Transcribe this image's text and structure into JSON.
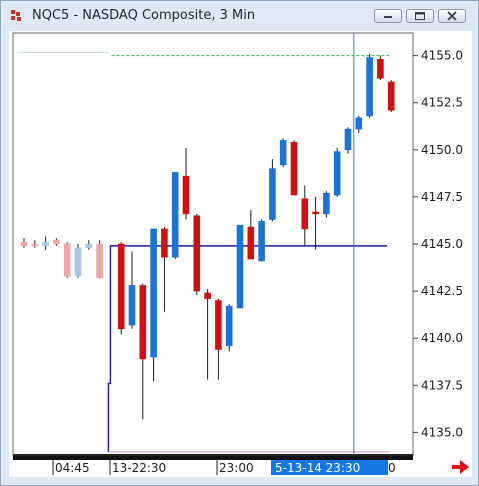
{
  "window": {
    "title": "NQC5 - NASDAQ Composite, 3 Min"
  },
  "chart_data": {
    "type": "candlestick",
    "symbol": "NQC5",
    "ylim": [
      4133.8,
      4156.2
    ],
    "price_ticks": [
      "4155.0",
      "4152.5",
      "4150.0",
      "4147.5",
      "4145.0",
      "4142.5",
      "4140.0",
      "4137.5",
      "4135.0"
    ],
    "price_tick_values": [
      4155.0,
      4152.5,
      4150.0,
      4147.5,
      4145.0,
      4142.5,
      4140.0,
      4137.5,
      4135.0
    ],
    "time_labels": [
      "04:45",
      "13-22:30",
      "23:00"
    ],
    "cursor_time_label": "5-13-14  23:30",
    "cursor_time_suffix": "0",
    "bar_count_total": 37,
    "ghost_candles": [
      {
        "i": 0,
        "o": 4145.1,
        "h": 4145.3,
        "l": 4144.8,
        "c": 4144.9,
        "dir": "down"
      },
      {
        "i": 1,
        "o": 4145.0,
        "h": 4145.2,
        "l": 4144.8,
        "c": 4144.9,
        "dir": "down"
      },
      {
        "i": 2,
        "o": 4144.9,
        "h": 4145.4,
        "l": 4144.7,
        "c": 4145.1,
        "dir": "up"
      },
      {
        "i": 3,
        "o": 4145.2,
        "h": 4145.3,
        "l": 4144.9,
        "c": 4145.0,
        "dir": "down"
      },
      {
        "i": 4,
        "o": 4145.0,
        "h": 4145.1,
        "l": 4143.2,
        "c": 4143.3,
        "dir": "down"
      },
      {
        "i": 5,
        "o": 4143.3,
        "h": 4145.0,
        "l": 4143.2,
        "c": 4144.8,
        "dir": "up"
      },
      {
        "i": 6,
        "o": 4144.8,
        "h": 4145.2,
        "l": 4144.7,
        "c": 4145.0,
        "dir": "up"
      },
      {
        "i": 7,
        "o": 4145.0,
        "h": 4145.2,
        "l": 4143.2,
        "c": 4143.2,
        "dir": "down"
      }
    ],
    "candles": [
      {
        "i": 9,
        "o": 4145.0,
        "h": 4145.1,
        "l": 4140.2,
        "c": 4140.5,
        "dir": "down"
      },
      {
        "i": 10,
        "o": 4140.7,
        "h": 4144.6,
        "l": 4140.5,
        "c": 4142.8,
        "dir": "up"
      },
      {
        "i": 11,
        "o": 4142.8,
        "h": 4142.9,
        "l": 4135.7,
        "c": 4138.9,
        "dir": "down"
      },
      {
        "i": 12,
        "o": 4139.0,
        "h": 4145.8,
        "l": 4137.7,
        "c": 4145.8,
        "dir": "up"
      },
      {
        "i": 13,
        "o": 4145.8,
        "h": 4145.9,
        "l": 4141.4,
        "c": 4144.3,
        "dir": "down"
      },
      {
        "i": 14,
        "o": 4144.3,
        "h": 4148.8,
        "l": 4144.2,
        "c": 4148.8,
        "dir": "up"
      },
      {
        "i": 15,
        "o": 4148.6,
        "h": 4150.1,
        "l": 4146.3,
        "c": 4146.6,
        "dir": "down"
      },
      {
        "i": 16,
        "o": 4146.5,
        "h": 4146.6,
        "l": 4142.3,
        "c": 4142.5,
        "dir": "down"
      },
      {
        "i": 17,
        "o": 4142.4,
        "h": 4142.6,
        "l": 4137.8,
        "c": 4142.1,
        "dir": "down"
      },
      {
        "i": 18,
        "o": 4142.0,
        "h": 4142.1,
        "l": 4137.8,
        "c": 4139.4,
        "dir": "down"
      },
      {
        "i": 19,
        "o": 4139.6,
        "h": 4141.8,
        "l": 4139.3,
        "c": 4141.7,
        "dir": "up"
      },
      {
        "i": 20,
        "o": 4141.6,
        "h": 4146.0,
        "l": 4141.6,
        "c": 4146.0,
        "dir": "up"
      },
      {
        "i": 21,
        "o": 4145.9,
        "h": 4146.8,
        "l": 4144.2,
        "c": 4144.2,
        "dir": "down"
      },
      {
        "i": 22,
        "o": 4144.1,
        "h": 4146.3,
        "l": 4144.1,
        "c": 4146.2,
        "dir": "up"
      },
      {
        "i": 23,
        "o": 4146.3,
        "h": 4149.5,
        "l": 4146.2,
        "c": 4149.0,
        "dir": "up"
      },
      {
        "i": 24,
        "o": 4149.2,
        "h": 4150.6,
        "l": 4149.1,
        "c": 4150.5,
        "dir": "up"
      },
      {
        "i": 25,
        "o": 4150.4,
        "h": 4150.5,
        "l": 4147.6,
        "c": 4147.6,
        "dir": "down"
      },
      {
        "i": 26,
        "o": 4147.4,
        "h": 4148.1,
        "l": 4144.9,
        "c": 4145.8,
        "dir": "down"
      },
      {
        "i": 27,
        "o": 4146.6,
        "h": 4147.5,
        "l": 4144.7,
        "c": 4146.7,
        "dir": "down"
      },
      {
        "i": 28,
        "o": 4146.6,
        "h": 4147.8,
        "l": 4146.4,
        "c": 4147.7,
        "dir": "up"
      },
      {
        "i": 29,
        "o": 4147.6,
        "h": 4150.1,
        "l": 4147.5,
        "c": 4149.9,
        "dir": "up"
      },
      {
        "i": 30,
        "o": 4150.0,
        "h": 4151.2,
        "l": 4149.8,
        "c": 4151.1,
        "dir": "up"
      },
      {
        "i": 31,
        "o": 4151.1,
        "h": 4151.8,
        "l": 4150.9,
        "c": 4151.7,
        "dir": "up"
      },
      {
        "i": 32,
        "o": 4151.8,
        "h": 4155.1,
        "l": 4151.7,
        "c": 4154.9,
        "dir": "up"
      },
      {
        "i": 33,
        "o": 4154.8,
        "h": 4155.0,
        "l": 4153.7,
        "c": 4153.8,
        "dir": "down"
      },
      {
        "i": 34,
        "o": 4153.6,
        "h": 4153.7,
        "l": 4152.0,
        "c": 4152.1,
        "dir": "down"
      }
    ],
    "high_line_price": 4155.0,
    "mid_line_price": 4144.9,
    "cursor_bar_index": 31,
    "session_start_index": 8,
    "colors": {
      "up": "#1e73d1",
      "down": "#cc1111",
      "ghost_up": "#a9c7e8",
      "ghost_down": "#e9a6a6",
      "high_line": "#2fb84a",
      "mid_line": "#1a1aa8",
      "low_line": "#d08cc0",
      "cursor": "#2f7fd1",
      "time_highlight": "#1577e6",
      "arrow": "#e01010"
    }
  }
}
